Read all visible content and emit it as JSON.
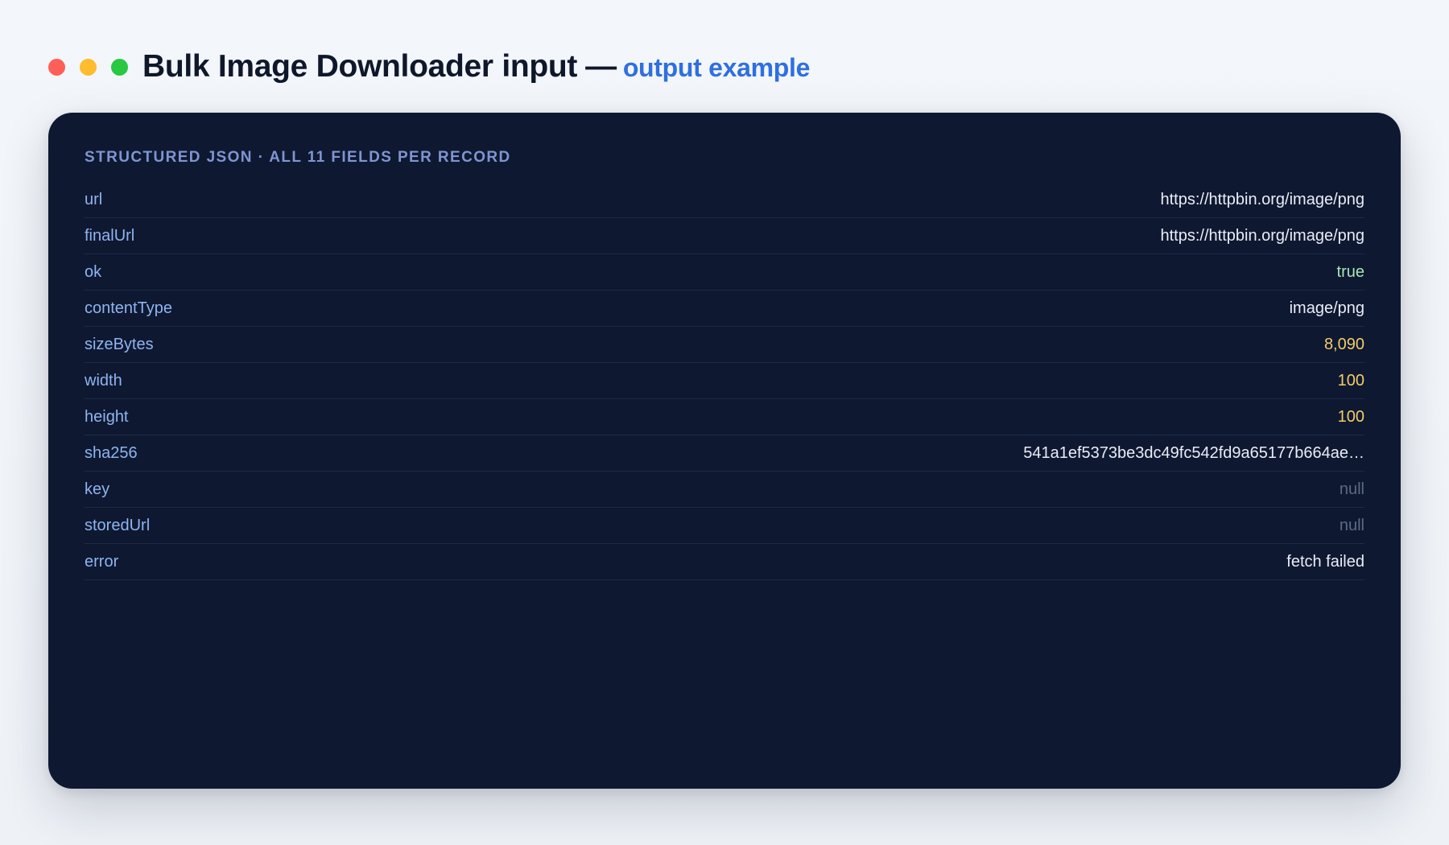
{
  "header": {
    "title": "Bulk Image Downloader input",
    "separator": "—",
    "subtitle": "output example",
    "window_controls": [
      "close-dot",
      "minimize-dot",
      "maximize-dot"
    ]
  },
  "card": {
    "heading": "STRUCTURED JSON · ALL 11 FIELDS PER RECORD",
    "fields": [
      {
        "key": "url",
        "value": "https://httpbin.org/image/png",
        "type": "string"
      },
      {
        "key": "finalUrl",
        "value": "https://httpbin.org/image/png",
        "type": "string"
      },
      {
        "key": "ok",
        "value": "true",
        "type": "bool"
      },
      {
        "key": "contentType",
        "value": "image/png",
        "type": "string"
      },
      {
        "key": "sizeBytes",
        "value": "8,090",
        "type": "num"
      },
      {
        "key": "width",
        "value": "100",
        "type": "num"
      },
      {
        "key": "height",
        "value": "100",
        "type": "num"
      },
      {
        "key": "sha256",
        "value": "541a1ef5373be3dc49fc542fd9a65177b664ae…",
        "type": "string"
      },
      {
        "key": "key",
        "value": "null",
        "type": "null"
      },
      {
        "key": "storedUrl",
        "value": "null",
        "type": "null"
      },
      {
        "key": "error",
        "value": "fetch failed",
        "type": "string"
      }
    ]
  },
  "colors": {
    "background": "#f3f6fa",
    "card": "#0e1831",
    "accent": "#2f6fe0",
    "key": "#8fb4ee",
    "string_value": "#e8edf6",
    "bool_value": "#a9e5b5",
    "number_value": "#f2cc6a",
    "null_value": "#5b6a86"
  }
}
